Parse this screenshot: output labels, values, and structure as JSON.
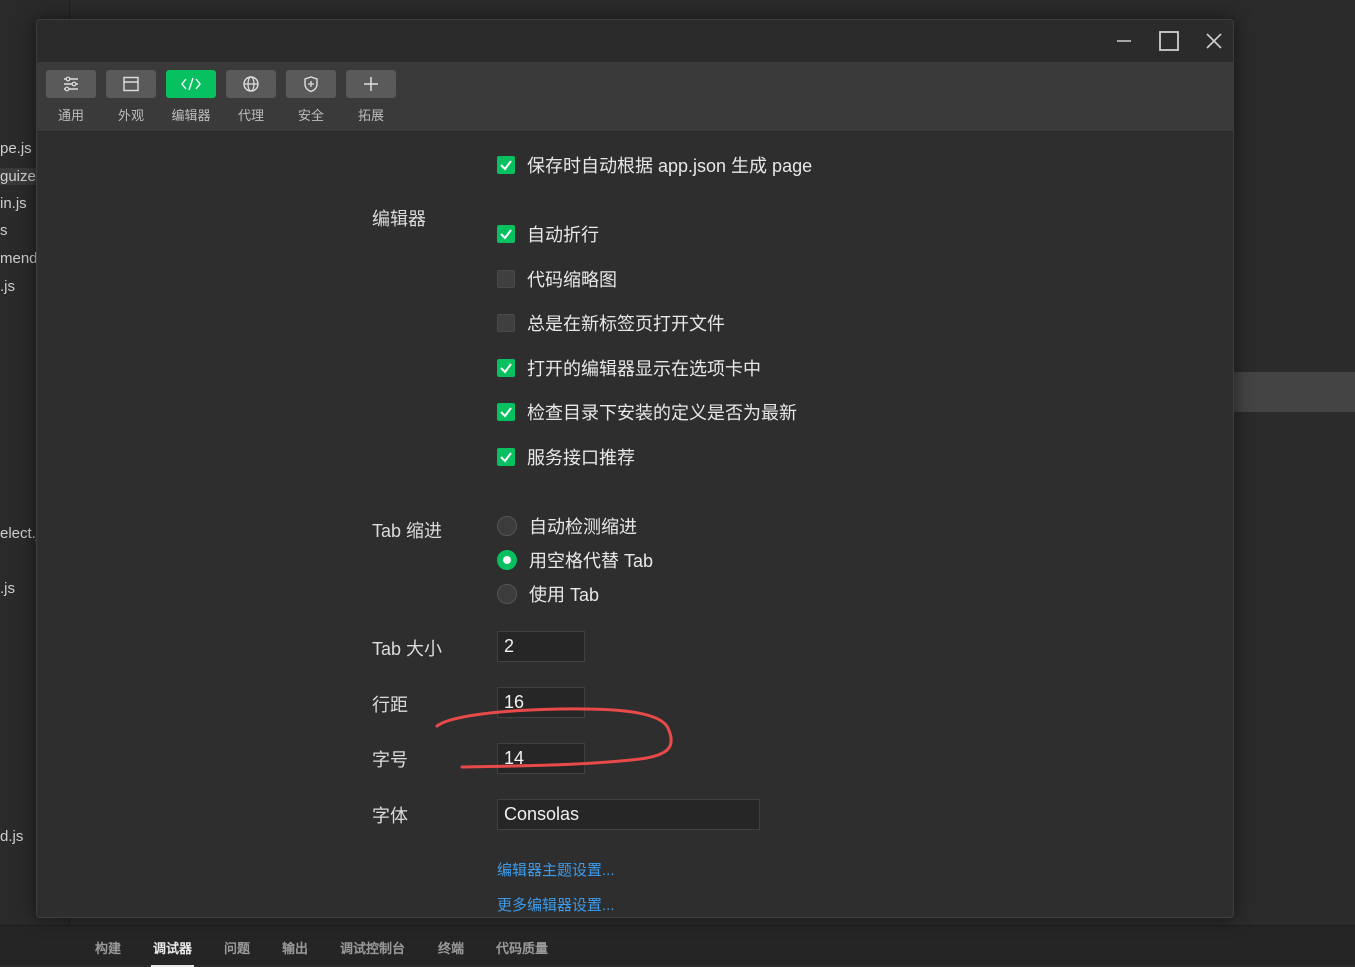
{
  "background": {
    "files": [
      "pe.js",
      "guize.j",
      "in.js",
      "s",
      "mend",
      ".js",
      "elect.j",
      ".js",
      "d.js"
    ]
  },
  "bottom_tabs": [
    "构建",
    "调试器",
    "问题",
    "输出",
    "调试控制台",
    "终端",
    "代码质量"
  ],
  "bottom_active": "调试器",
  "window_controls": {
    "minimize": "minimize-icon",
    "maximize": "maximize-icon",
    "close": "close-icon"
  },
  "toolbar": {
    "items": [
      {
        "label": "通用",
        "icon": "sliders-icon"
      },
      {
        "label": "外观",
        "icon": "layout-icon"
      },
      {
        "label": "编辑器",
        "icon": "code-icon"
      },
      {
        "label": "代理",
        "icon": "globe-icon"
      },
      {
        "label": "安全",
        "icon": "shield-icon"
      },
      {
        "label": "拓展",
        "icon": "plus-icon"
      }
    ],
    "active": "编辑器"
  },
  "settings": {
    "auto_page": {
      "label": "保存时自动根据 app.json 生成 page",
      "checked": true
    },
    "editor_section": "编辑器",
    "editor_options": [
      {
        "label": "自动折行",
        "checked": true
      },
      {
        "label": "代码缩略图",
        "checked": false
      },
      {
        "label": "总是在新标签页打开文件",
        "checked": false
      },
      {
        "label": "打开的编辑器显示在选项卡中",
        "checked": true
      },
      {
        "label": "检查目录下安装的定义是否为最新",
        "checked": true
      },
      {
        "label": "服务接口推荐",
        "checked": true
      }
    ],
    "tab_indent_label": "Tab 缩进",
    "tab_indent_options": [
      {
        "label": "自动检测缩进",
        "selected": false
      },
      {
        "label": "用空格代替 Tab",
        "selected": true
      },
      {
        "label": "使用 Tab",
        "selected": false
      }
    ],
    "tab_size_label": "Tab 大小",
    "tab_size": "2",
    "line_height_label": "行距",
    "line_height": "16",
    "font_size_label": "字号",
    "font_size": "14",
    "font_family_label": "字体",
    "font_family": "Consolas",
    "links": [
      "编辑器主题设置...",
      "更多编辑器设置..."
    ]
  },
  "colors": {
    "accent": "#07c160",
    "link": "#3d9be9",
    "annotation": "#e84a4a"
  }
}
